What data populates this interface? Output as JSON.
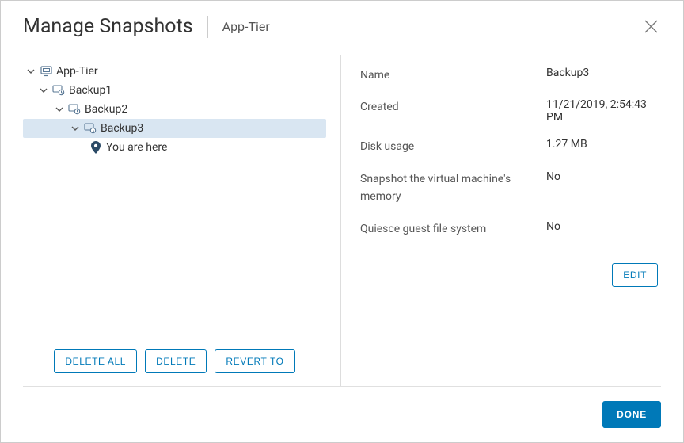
{
  "header": {
    "title": "Manage Snapshots",
    "subtitle": "App-Tier"
  },
  "tree": {
    "root": "App-Tier",
    "n1": "Backup1",
    "n2": "Backup2",
    "n3": "Backup3",
    "here": "You are here"
  },
  "actions": {
    "delete_all": "DELETE ALL",
    "delete": "DELETE",
    "revert_to": "REVERT TO",
    "edit": "EDIT",
    "done": "DONE"
  },
  "details": {
    "name_label": "Name",
    "name_value": "Backup3",
    "created_label": "Created",
    "created_value": "11/21/2019, 2:54:43 PM",
    "disk_label": "Disk usage",
    "disk_value": "1.27 MB",
    "mem_label": "Snapshot the virtual machine's memory",
    "mem_value": "No",
    "quiesce_label": "Quiesce guest file system",
    "quiesce_value": "No"
  }
}
